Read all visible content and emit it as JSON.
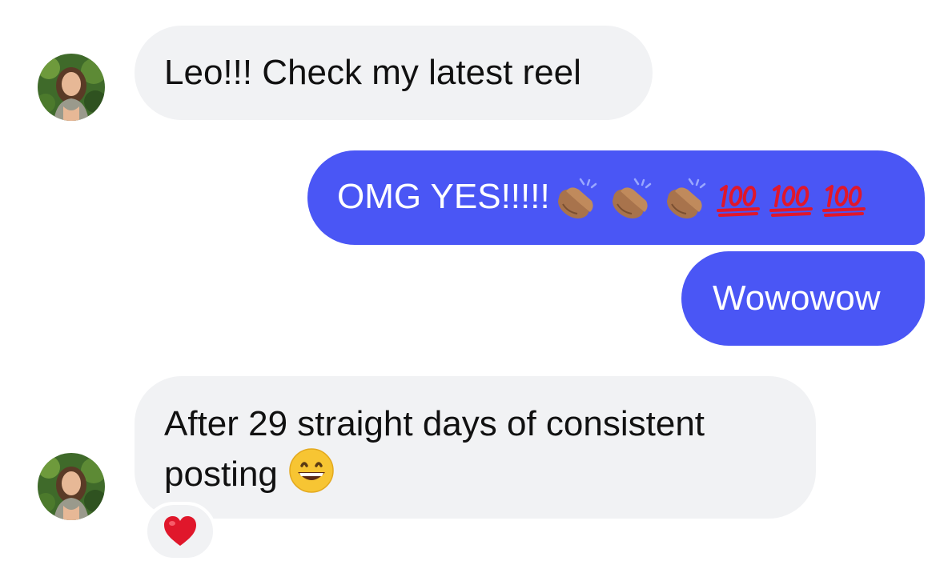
{
  "messages": [
    {
      "direction": "incoming",
      "text": "Leo!!! Check my latest reel",
      "has_avatar": true
    },
    {
      "direction": "outgoing",
      "text": "OMG YES!!!!!",
      "emoji": [
        "clapping-hands-icon",
        "clapping-hands-icon",
        "clapping-hands-icon",
        "hundred-points-icon",
        "hundred-points-icon",
        "hundred-points-icon"
      ]
    },
    {
      "direction": "outgoing",
      "text": "Wowowow"
    },
    {
      "direction": "incoming",
      "text": "After 29 straight days of consistent posting",
      "emoji": [
        "grinning-face-icon"
      ],
      "reaction": "red-heart-icon",
      "has_avatar": true
    }
  ],
  "colors": {
    "incoming_bubble": "#f1f2f4",
    "outgoing_bubble": "#4a56f5",
    "incoming_text": "#111111",
    "outgoing_text": "#ffffff",
    "heart": "#e0172b"
  }
}
